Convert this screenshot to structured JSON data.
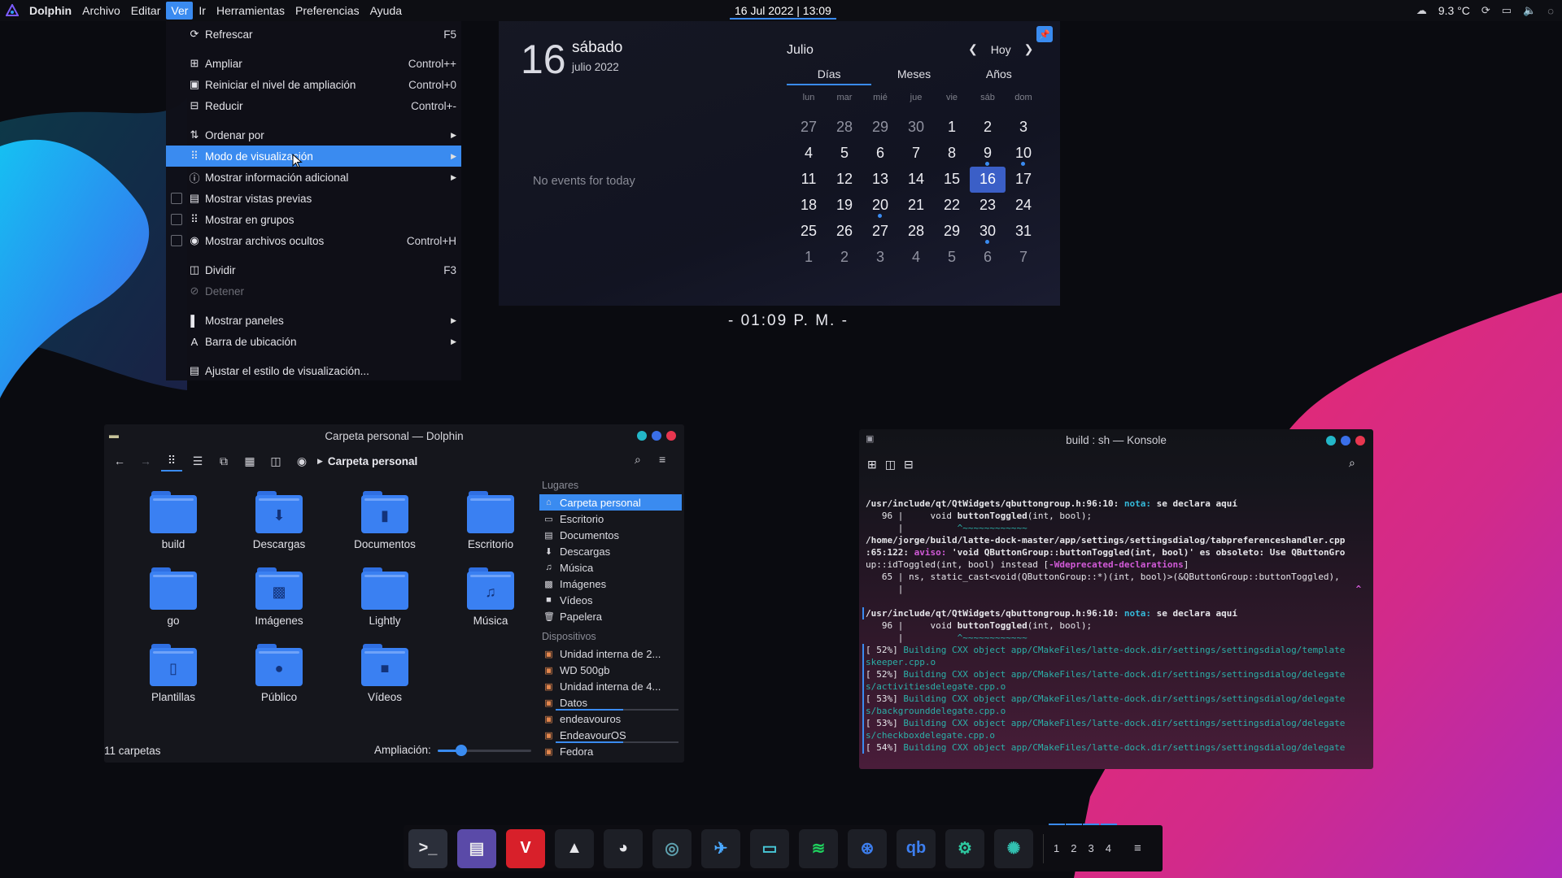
{
  "topbar": {
    "app_name": "Dolphin",
    "menus": [
      "Archivo",
      "Editar",
      "Ver",
      "Ir",
      "Herramientas",
      "Preferencias",
      "Ayuda"
    ],
    "active_menu": "Ver",
    "clock": "16 Jul 2022 | 13:09",
    "temperature": "9.3 °C"
  },
  "view_menu": {
    "items": [
      {
        "label": "Refrescar",
        "shortcut": "F5",
        "icon": "refresh-icon"
      },
      {
        "label": "Ampliar",
        "shortcut": "Control++",
        "icon": "zoom-in-icon"
      },
      {
        "label": "Reiniciar el nivel de ampliación",
        "shortcut": "Control+0",
        "icon": "zoom-reset-icon"
      },
      {
        "label": "Reducir",
        "shortcut": "Control+-",
        "icon": "zoom-out-icon"
      },
      {
        "label": "Ordenar por",
        "icon": "sort-icon",
        "submenu": true
      },
      {
        "label": "Modo de visualización",
        "icon": "view-mode-icon",
        "submenu": true,
        "highlighted": true
      },
      {
        "label": "Mostrar información adicional",
        "icon": "info-icon",
        "submenu": true
      },
      {
        "label": "Mostrar vistas previas",
        "icon": "preview-icon",
        "checkbox": true
      },
      {
        "label": "Mostrar en grupos",
        "icon": "groups-icon",
        "checkbox": true
      },
      {
        "label": "Mostrar archivos ocultos",
        "shortcut": "Control+H",
        "icon": "eye-icon",
        "checkbox": true
      },
      {
        "label": "Dividir",
        "shortcut": "F3",
        "icon": "split-icon"
      },
      {
        "label": "Detener",
        "icon": "stop-icon",
        "disabled": true
      },
      {
        "label": "Mostrar paneles",
        "icon": "panels-icon",
        "submenu": true
      },
      {
        "label": "Barra de ubicación",
        "icon": "location-bar-icon",
        "submenu": true
      },
      {
        "label": "Ajustar el estilo de visualización...",
        "icon": "view-style-icon"
      }
    ]
  },
  "calendar": {
    "day_number": "16",
    "day_name": "sábado",
    "month_year": "julio 2022",
    "no_events": "No events for today",
    "month": "Julio",
    "today_label": "Hoy",
    "tabs": [
      "Días",
      "Meses",
      "Años"
    ],
    "selected_tab": "Días",
    "weekdays": [
      "lun",
      "mar",
      "mié",
      "jue",
      "vie",
      "sáb",
      "dom"
    ],
    "days": [
      [
        "27",
        "28",
        "29",
        "30",
        "1",
        "2",
        "3"
      ],
      [
        "4",
        "5",
        "6",
        "7",
        "8",
        "9",
        "10"
      ],
      [
        "11",
        "12",
        "13",
        "14",
        "15",
        "16",
        "17"
      ],
      [
        "18",
        "19",
        "20",
        "21",
        "22",
        "23",
        "24"
      ],
      [
        "25",
        "26",
        "27",
        "28",
        "29",
        "30",
        "31"
      ],
      [
        "1",
        "2",
        "3",
        "4",
        "5",
        "6",
        "7"
      ]
    ],
    "today": "16",
    "event_days": [
      "9",
      "10",
      "20",
      "30"
    ],
    "clock": "- 01:09 P. M. -"
  },
  "dolphin": {
    "title": "Carpeta personal — Dolphin",
    "breadcrumb": "Carpeta personal",
    "folders": [
      {
        "name": "build",
        "icon": "folder-icon"
      },
      {
        "name": "Descargas",
        "icon": "download-icon"
      },
      {
        "name": "Documentos",
        "icon": "document-icon"
      },
      {
        "name": "Escritorio",
        "icon": "desktop-icon"
      },
      {
        "name": "go",
        "icon": "folder-icon"
      },
      {
        "name": "Imágenes",
        "icon": "image-icon"
      },
      {
        "name": "Lightly",
        "icon": "folder-icon"
      },
      {
        "name": "Música",
        "icon": "music-icon"
      },
      {
        "name": "Plantillas",
        "icon": "template-icon"
      },
      {
        "name": "Público",
        "icon": "public-icon"
      },
      {
        "name": "Vídeos",
        "icon": "video-icon"
      }
    ],
    "places_header": "Lugares",
    "places": [
      "Carpeta personal",
      "Escritorio",
      "Documentos",
      "Descargas",
      "Música",
      "Imágenes",
      "Vídeos",
      "Papelera"
    ],
    "devices_header": "Dispositivos",
    "devices": [
      "Unidad interna de 2...",
      "WD 500gb",
      "Unidad interna de 4...",
      "Datos",
      "endeavouros",
      "EndeavourOS",
      "Fedora"
    ],
    "status": "11 carpetas",
    "zoom_label": "Ampliación:",
    "zoom_level": 0.25
  },
  "konsole": {
    "title": "build : sh — Konsole",
    "lines": [
      [
        {
          "t": "/usr/include/qt/QtWidgets/qbuttongroup.h:96:10: ",
          "c": "b"
        },
        {
          "t": "nota:",
          "c": "c"
        },
        {
          "t": " se declara aquí",
          "c": "b"
        }
      ],
      [
        {
          "t": "   96 |     void ",
          "c": ""
        },
        {
          "t": "buttonToggled",
          "c": "b"
        },
        {
          "t": "(int, bool);",
          "c": ""
        }
      ],
      [
        {
          "t": "      |          ",
          "c": ""
        },
        {
          "t": "^~~~~~~~~~~~~",
          "c": "g"
        }
      ],
      [
        {
          "t": "/home/jorge/build/latte-dock-master/app/settings/settingsdialog/tabpreferenceshandler.cpp",
          "c": "b"
        }
      ],
      [
        {
          "t": ":65:122: ",
          "c": "b"
        },
        {
          "t": "aviso:",
          "c": "m"
        },
        {
          "t": " 'void QButtonGroup::buttonToggled(int, bool)' es obsoleto: Use QButtonGro",
          "c": "b"
        }
      ],
      [
        {
          "t": "up::idToggled(int, bool) instead [",
          "c": ""
        },
        {
          "t": "-Wdeprecated-declarations",
          "c": "m"
        },
        {
          "t": "]",
          "c": ""
        }
      ],
      [
        {
          "t": "   65 | ns, static_cast<void(QButtonGroup::*)(int, bool)>(&QButtonGroup::buttonToggled),",
          "c": ""
        }
      ],
      [
        {
          "t": "      |                                                                                    ",
          "c": ""
        },
        {
          "t": "^",
          "c": "m"
        }
      ],
      [
        {
          "t": "",
          "c": ""
        }
      ],
      [
        {
          "t": "/usr/include/qt/QtWidgets/qbuttongroup.h:96:10: ",
          "c": "b"
        },
        {
          "t": "nota:",
          "c": "c"
        },
        {
          "t": " se declara aquí",
          "c": "b"
        }
      ],
      [
        {
          "t": "   96 |     void ",
          "c": ""
        },
        {
          "t": "buttonToggled",
          "c": "b"
        },
        {
          "t": "(int, bool);",
          "c": ""
        }
      ],
      [
        {
          "t": "      |          ",
          "c": ""
        },
        {
          "t": "^~~~~~~~~~~~~",
          "c": "g"
        }
      ],
      [
        {
          "t": "[ 52%] ",
          "c": ""
        },
        {
          "t": "Building CXX object app/CMakeFiles/latte-dock.dir/settings/settingsdialog/template",
          "c": "g"
        }
      ],
      [
        {
          "t": "skeeper.cpp.o",
          "c": "g"
        }
      ],
      [
        {
          "t": "[ 52%] ",
          "c": ""
        },
        {
          "t": "Building CXX object app/CMakeFiles/latte-dock.dir/settings/settingsdialog/delegate",
          "c": "g"
        }
      ],
      [
        {
          "t": "s/activitiesdelegate.cpp.o",
          "c": "g"
        }
      ],
      [
        {
          "t": "[ 53%] ",
          "c": ""
        },
        {
          "t": "Building CXX object app/CMakeFiles/latte-dock.dir/settings/settingsdialog/delegate",
          "c": "g"
        }
      ],
      [
        {
          "t": "s/backgrounddelegate.cpp.o",
          "c": "g"
        }
      ],
      [
        {
          "t": "[ 53%] ",
          "c": ""
        },
        {
          "t": "Building CXX object app/CMakeFiles/latte-dock.dir/settings/settingsdialog/delegate",
          "c": "g"
        }
      ],
      [
        {
          "t": "s/checkboxdelegate.cpp.o",
          "c": "g"
        }
      ],
      [
        {
          "t": "[ 54%] ",
          "c": ""
        },
        {
          "t": "Building CXX object app/CMakeFiles/latte-dock.dir/settings/settingsdialog/delegate",
          "c": "g"
        }
      ]
    ]
  },
  "dock": {
    "apps": [
      {
        "name": "terminal-icon",
        "bg": "#2b2f3a"
      },
      {
        "name": "file-manager-icon",
        "bg": "#5a4aa8"
      },
      {
        "name": "vivaldi-icon",
        "bg": "#d8202a"
      },
      {
        "name": "inkscape-icon",
        "bg": "#1d1f26"
      },
      {
        "name": "gimp-icon",
        "bg": "#1d1f26"
      },
      {
        "name": "lens-icon",
        "bg": "#1d1f26"
      },
      {
        "name": "kdeconnect-icon",
        "bg": "#1d1f26"
      },
      {
        "name": "vlc-icon",
        "bg": "#1d1f26"
      },
      {
        "name": "spotify-icon",
        "bg": "#1d1f26"
      },
      {
        "name": "steam-icon",
        "bg": "#1d1f26"
      },
      {
        "name": "qbittorrent-icon",
        "bg": "#1d1f26"
      },
      {
        "name": "settings-icon",
        "bg": "#1d1f26"
      },
      {
        "name": "aperture-icon",
        "bg": "#1d1f26"
      }
    ],
    "desktops": [
      "1",
      "2",
      "3",
      "4"
    ]
  }
}
